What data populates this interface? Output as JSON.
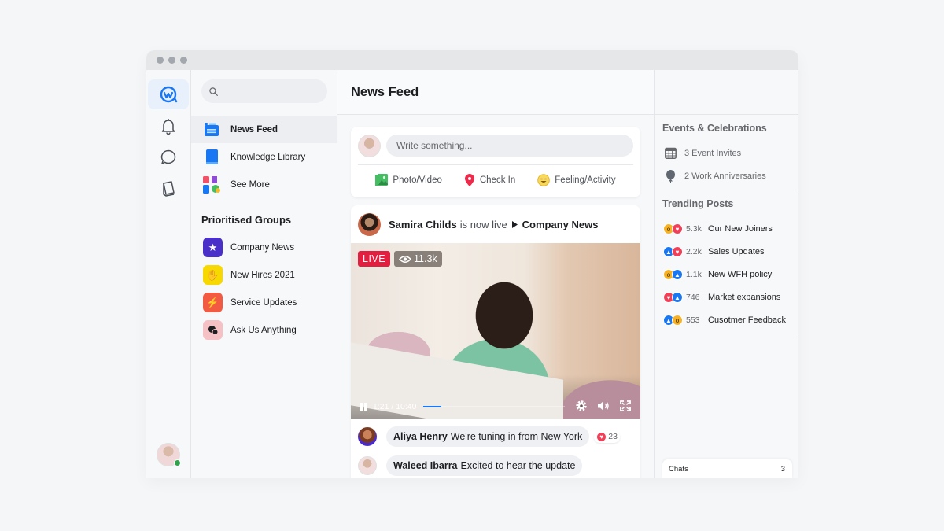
{
  "window": {
    "controls": [
      "close",
      "minimize",
      "maximize"
    ]
  },
  "rail": {
    "items": [
      {
        "name": "workplace-logo",
        "icon": "workplace-logo-icon",
        "active": true
      },
      {
        "name": "notifications",
        "icon": "bell-icon"
      },
      {
        "name": "chats",
        "icon": "chat-bubble-icon"
      },
      {
        "name": "library",
        "icon": "book-icon"
      }
    ],
    "user_status": "online"
  },
  "nav": {
    "search": {
      "placeholder": "",
      "value": ""
    },
    "items": [
      {
        "label": "News Feed",
        "icon": "news-feed-icon",
        "active": true
      },
      {
        "label": "Knowledge Library",
        "icon": "book-icon"
      },
      {
        "label": "See More",
        "icon": "apps-grid-icon"
      }
    ],
    "groups_title": "Prioritised Groups",
    "groups": [
      {
        "label": "Company News",
        "icon": "star-icon",
        "color": "#4a2fc9"
      },
      {
        "label": "New Hires 2021",
        "icon": "hand-wave-icon",
        "color": "#f7d800"
      },
      {
        "label": "Service Updates",
        "icon": "lightning-icon",
        "color": "#f25b42"
      },
      {
        "label": "Ask Us Anything",
        "icon": "speech-bubbles-icon",
        "color": "#f6c1c4"
      }
    ]
  },
  "main": {
    "title": "News Feed",
    "composer": {
      "placeholder": "Write something...",
      "actions": [
        {
          "label": "Photo/Video",
          "icon": "photo-icon",
          "color": "#45bd62"
        },
        {
          "label": "Check In",
          "icon": "location-pin-icon",
          "color": "#f02849"
        },
        {
          "label": "Feeling/Activity",
          "icon": "smiley-icon",
          "color": "#f7b928"
        }
      ]
    },
    "post": {
      "author": "Samira Childs",
      "action": "is now live",
      "target": "Company News",
      "video": {
        "live_label": "LIVE",
        "viewers": "11.3k",
        "time": "1:21 / 10:40",
        "progress": 0.127
      },
      "comments": [
        {
          "author": "Aliya Henry",
          "text": "We're tuning in from New York",
          "reaction": "heart",
          "reaction_count": "23"
        },
        {
          "author": "Waleed Ibarra",
          "text": "Excited to hear the update"
        }
      ]
    }
  },
  "right": {
    "events_title": "Events & Celebrations",
    "events": [
      {
        "label": "3 Event Invites",
        "icon": "calendar-icon"
      },
      {
        "label": "2 Work Anniversaries",
        "icon": "balloon-icon"
      }
    ],
    "trending_title": "Trending Posts",
    "trending": [
      {
        "reactions": [
          "wow",
          "heart"
        ],
        "count": "5.3k",
        "title": "Our New Joiners"
      },
      {
        "reactions": [
          "like",
          "heart"
        ],
        "count": "2.2k",
        "title": "Sales Updates"
      },
      {
        "reactions": [
          "wow",
          "like"
        ],
        "count": "1.1k",
        "title": "New WFH policy"
      },
      {
        "reactions": [
          "heart",
          "like"
        ],
        "count": "746",
        "title": "Market expansions"
      },
      {
        "reactions": [
          "like",
          "wow"
        ],
        "count": "553",
        "title": "Cusotmer Feedback"
      }
    ],
    "chats": {
      "label": "Chats",
      "count": "3"
    }
  }
}
